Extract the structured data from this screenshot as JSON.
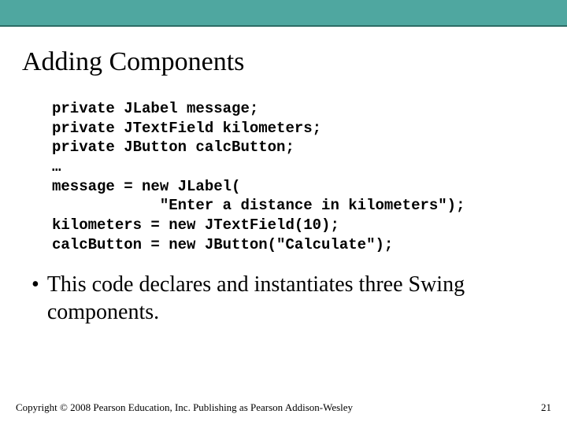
{
  "header": {
    "title": "Adding Components"
  },
  "code": {
    "lines": "private JLabel message;\nprivate JTextField kilometers;\nprivate JButton calcButton;\n…\nmessage = new JLabel(\n            \"Enter a distance in kilometers\");\nkilometers = new JTextField(10);\ncalcButton = new JButton(\"Calculate\");"
  },
  "bullet": {
    "marker": "•",
    "text": "This code declares and instantiates three Swing components."
  },
  "footer": {
    "copyright": "Copyright © 2008 Pearson Education, Inc. Publishing as Pearson Addison-Wesley",
    "page": "21"
  }
}
